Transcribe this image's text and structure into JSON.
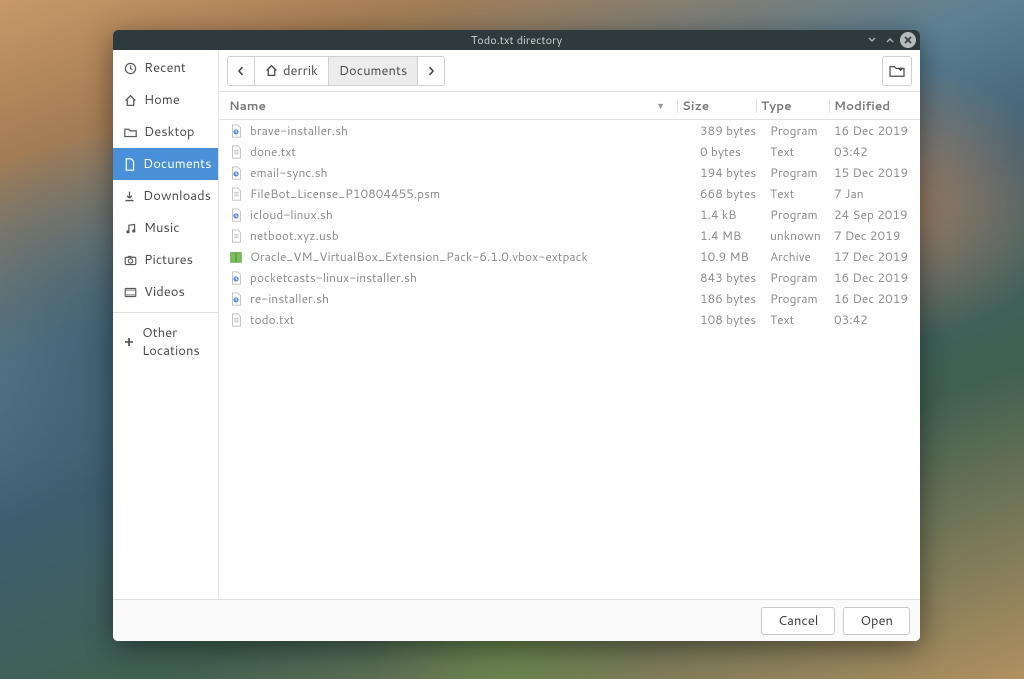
{
  "window": {
    "title": "Todo.txt directory"
  },
  "breadcrumb": {
    "home_user": "derrik",
    "current": "Documents"
  },
  "sidebar": {
    "items": [
      {
        "id": "recent",
        "label": "Recent",
        "icon": "clock-icon"
      },
      {
        "id": "home",
        "label": "Home",
        "icon": "home-icon"
      },
      {
        "id": "desktop",
        "label": "Desktop",
        "icon": "folder-icon"
      },
      {
        "id": "documents",
        "label": "Documents",
        "icon": "doc-icon",
        "active": true
      },
      {
        "id": "downloads",
        "label": "Downloads",
        "icon": "download-icon"
      },
      {
        "id": "music",
        "label": "Music",
        "icon": "music-icon"
      },
      {
        "id": "pictures",
        "label": "Pictures",
        "icon": "camera-icon"
      },
      {
        "id": "videos",
        "label": "Videos",
        "icon": "video-icon"
      }
    ],
    "other_locations_label": "Other Locations"
  },
  "columns": {
    "name": "Name",
    "size": "Size",
    "type": "Type",
    "modified": "Modified"
  },
  "files": [
    {
      "name": "brave-installer.sh",
      "size": "389 bytes",
      "type": "Program",
      "modified": "16 Dec 2019",
      "icon": "script"
    },
    {
      "name": "done.txt",
      "size": "0 bytes",
      "type": "Text",
      "modified": "03:42",
      "icon": "text"
    },
    {
      "name": "email-sync.sh",
      "size": "194 bytes",
      "type": "Program",
      "modified": "15 Dec 2019",
      "icon": "script"
    },
    {
      "name": "FileBot_License_P10804455.psm",
      "size": "668 bytes",
      "type": "Text",
      "modified": "7 Jan",
      "icon": "text"
    },
    {
      "name": "icloud-linux.sh",
      "size": "1.4 kB",
      "type": "Program",
      "modified": "24 Sep 2019",
      "icon": "script"
    },
    {
      "name": "netboot.xyz.usb",
      "size": "1.4 MB",
      "type": "unknown",
      "modified": "7 Dec 2019",
      "icon": "text"
    },
    {
      "name": "Oracle_VM_VirtualBox_Extension_Pack-6.1.0.vbox-extpack",
      "size": "10.9 MB",
      "type": "Archive",
      "modified": "17 Dec 2019",
      "icon": "archive"
    },
    {
      "name": "pocketcasts-linux-installer.sh",
      "size": "843 bytes",
      "type": "Program",
      "modified": "16 Dec 2019",
      "icon": "script"
    },
    {
      "name": "re-installer.sh",
      "size": "186 bytes",
      "type": "Program",
      "modified": "16 Dec 2019",
      "icon": "script"
    },
    {
      "name": "todo.txt",
      "size": "108 bytes",
      "type": "Text",
      "modified": "03:42",
      "icon": "text"
    }
  ],
  "footer": {
    "cancel": "Cancel",
    "open": "Open"
  }
}
